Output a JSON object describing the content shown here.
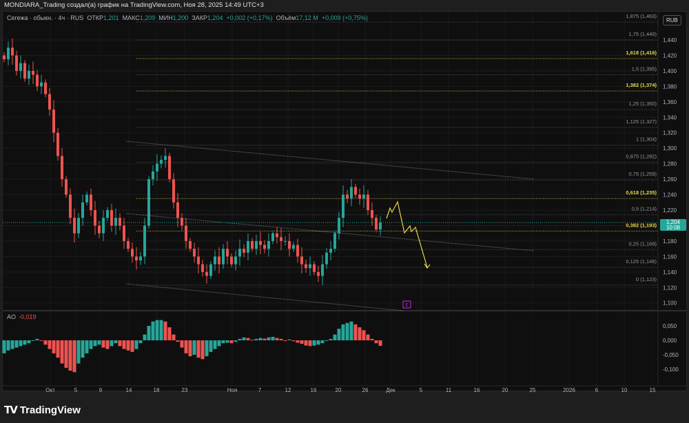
{
  "header": {
    "attribution": "MONDIARA_Trading создал(а) график на TradingView.com, Ноя 28, 2025 14:49 UTC+3"
  },
  "legend": {
    "symbol": "Сегежа · обыкн. · 4ч · RUS",
    "open_label": "ОТКР",
    "open": "1,201",
    "high_label": "МАКС",
    "high": "1,209",
    "low_label": "МИН",
    "low": "1,200",
    "close_label": "ЗАКР",
    "close": "1,204",
    "change": "+0,002 (+0,17%)",
    "volume_label": "Объём",
    "volume": "17,12 M",
    "vol_change": "+0,009 (+0,75%)"
  },
  "currency": "RUB",
  "last_price": {
    "price": "1,204",
    "countdown": "10:08",
    "value": 1.204
  },
  "indicator": {
    "name": "AO",
    "value": "-0,019"
  },
  "colors": {
    "up": "#26a69a",
    "down": "#ef5350",
    "fib_key": "#e8d84a",
    "fib": "#787b86",
    "forecast": "#e8d84a",
    "earnings": "#b71cd6"
  },
  "brand": "TradingView",
  "chart_data": {
    "type": "candlestick",
    "price_axis": {
      "ticks": [
        "1,440",
        "1,420",
        "1,400",
        "1,380",
        "1,360",
        "1,340",
        "1,320",
        "1,300",
        "1,280",
        "1,260",
        "1,240",
        "1,220",
        "1,200",
        "1,180",
        "1,160",
        "1,140",
        "1,120",
        "1,100"
      ],
      "range": [
        1.085,
        1.47
      ]
    },
    "time_axis": {
      "ticks": [
        "Окт",
        "5",
        "9",
        "14",
        "18",
        "23",
        "Ноя",
        "7",
        "12",
        "16",
        "20",
        "26",
        "Дек",
        "5",
        "11",
        "16",
        "20",
        "25",
        "2026",
        "6",
        "10",
        "15"
      ]
    },
    "closes": [
      1.415,
      1.43,
      1.42,
      1.4,
      1.41,
      1.39,
      1.4,
      1.395,
      1.38,
      1.385,
      1.37,
      1.35,
      1.32,
      1.29,
      1.26,
      1.24,
      1.21,
      1.19,
      1.21,
      1.23,
      1.24,
      1.22,
      1.2,
      1.19,
      1.21,
      1.22,
      1.2,
      1.21,
      1.2,
      1.18,
      1.17,
      1.16,
      1.155,
      1.16,
      1.2,
      1.26,
      1.27,
      1.28,
      1.285,
      1.29,
      1.26,
      1.23,
      1.21,
      1.2,
      1.18,
      1.17,
      1.16,
      1.15,
      1.14,
      1.135,
      1.15,
      1.16,
      1.15,
      1.17,
      1.16,
      1.15,
      1.16,
      1.17,
      1.165,
      1.18,
      1.17,
      1.18,
      1.175,
      1.17,
      1.18,
      1.19,
      1.185,
      1.18,
      1.18,
      1.17,
      1.175,
      1.16,
      1.15,
      1.145,
      1.15,
      1.14,
      1.135,
      1.15,
      1.165,
      1.17,
      1.19,
      1.21,
      1.24,
      1.235,
      1.25,
      1.24,
      1.235,
      1.24,
      1.22,
      1.21,
      1.195,
      1.204
    ],
    "fib_levels": [
      {
        "ratio": "0",
        "price": 1.123,
        "label": "0 (1,123)"
      },
      {
        "ratio": "0.125",
        "price": 1.146,
        "label": "0,125 (1,146)"
      },
      {
        "ratio": "0.25",
        "price": 1.169,
        "label": "0,25 (1,169)"
      },
      {
        "ratio": "0.382",
        "price": 1.193,
        "label": "0,382 (1,193)",
        "key": true
      },
      {
        "ratio": "0.5",
        "price": 1.214,
        "label": "0,5 (1,214)"
      },
      {
        "ratio": "0.618",
        "price": 1.235,
        "label": "0,618 (1,235)",
        "key": true
      },
      {
        "ratio": "0.75",
        "price": 1.259,
        "label": "0,75 (1,259)"
      },
      {
        "ratio": "0.875",
        "price": 1.282,
        "label": "0,875 (1,282)"
      },
      {
        "ratio": "1",
        "price": 1.304,
        "label": "1 (1,304)"
      },
      {
        "ratio": "1.125",
        "price": 1.327,
        "label": "1,125 (1,327)"
      },
      {
        "ratio": "1.25",
        "price": 1.35,
        "label": "1,25 (1,350)"
      },
      {
        "ratio": "1.382",
        "price": 1.374,
        "label": "1,382 (1,374)",
        "key": true
      },
      {
        "ratio": "1.5",
        "price": 1.395,
        "label": "1,5 (1,395)"
      },
      {
        "ratio": "1.618",
        "price": 1.416,
        "label": "1,618 (1,416)",
        "key": true
      },
      {
        "ratio": "1.75",
        "price": 1.44,
        "label": "1,75 (1,440)"
      },
      {
        "ratio": "1.875",
        "price": 1.463,
        "label": "1,875 (1,463)"
      }
    ],
    "ao": {
      "axis_ticks": [
        "0,050",
        "0,000",
        "-0,050",
        "-0,100"
      ],
      "values": [
        -0.045,
        -0.035,
        -0.03,
        -0.025,
        -0.02,
        -0.015,
        -0.01,
        0.0,
        0.005,
        0.0,
        -0.015,
        -0.03,
        -0.045,
        -0.06,
        -0.08,
        -0.095,
        -0.105,
        -0.11,
        -0.08,
        -0.06,
        -0.045,
        -0.03,
        -0.02,
        -0.015,
        -0.025,
        -0.03,
        -0.02,
        -0.01,
        -0.02,
        -0.03,
        -0.035,
        -0.04,
        -0.03,
        -0.01,
        0.02,
        0.05,
        0.065,
        0.07,
        0.07,
        0.065,
        0.045,
        0.02,
        -0.005,
        -0.025,
        -0.045,
        -0.055,
        -0.05,
        -0.06,
        -0.065,
        -0.055,
        -0.04,
        -0.03,
        -0.02,
        -0.01,
        -0.008,
        -0.01,
        -0.005,
        0.005,
        0.01,
        0.008,
        0.002,
        0.005,
        0.008,
        0.006,
        0.01,
        0.012,
        0.008,
        0.005,
        0.0,
        0.003,
        -0.003,
        -0.008,
        -0.012,
        -0.018,
        -0.02,
        -0.018,
        -0.015,
        -0.01,
        -0.002,
        0.005,
        0.02,
        0.04,
        0.055,
        0.06,
        0.065,
        0.055,
        0.045,
        0.035,
        0.02,
        0.005,
        -0.01,
        -0.019
      ]
    },
    "earnings_marker": "E"
  }
}
